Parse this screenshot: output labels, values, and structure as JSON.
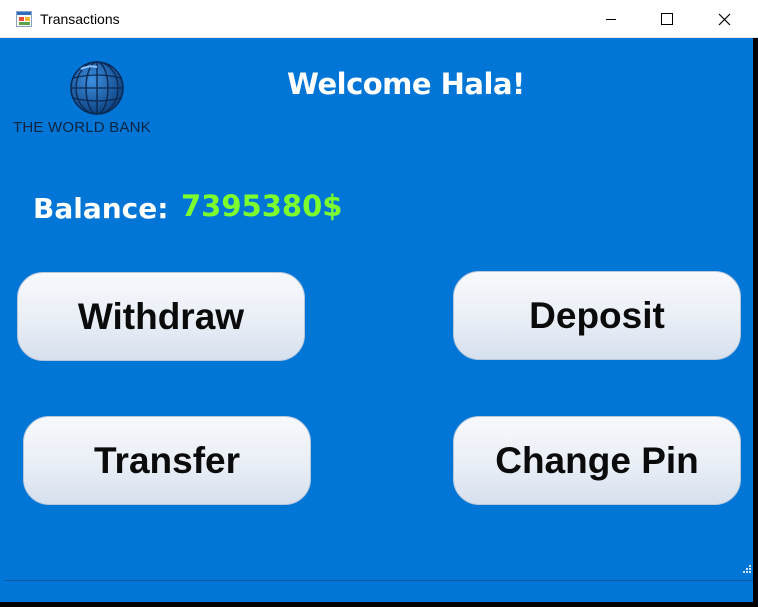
{
  "window": {
    "title": "Transactions"
  },
  "header": {
    "logo_text": "THE WORLD BANK",
    "welcome": "Welcome Hala!"
  },
  "balance": {
    "label": "Balance:",
    "value": "7395380$"
  },
  "actions": {
    "withdraw": "Withdraw",
    "deposit": "Deposit",
    "transfer": "Transfer",
    "change_pin": "Change Pin"
  },
  "colors": {
    "background": "#0176d6",
    "balance_value": "#7dff2e",
    "button_text": "#0b0b0b"
  },
  "icons": {
    "app": "form-icon",
    "logo": "globe-icon",
    "minimize": "minimize-icon",
    "maximize": "maximize-icon",
    "close": "close-icon",
    "grip": "resize-grip-icon"
  }
}
